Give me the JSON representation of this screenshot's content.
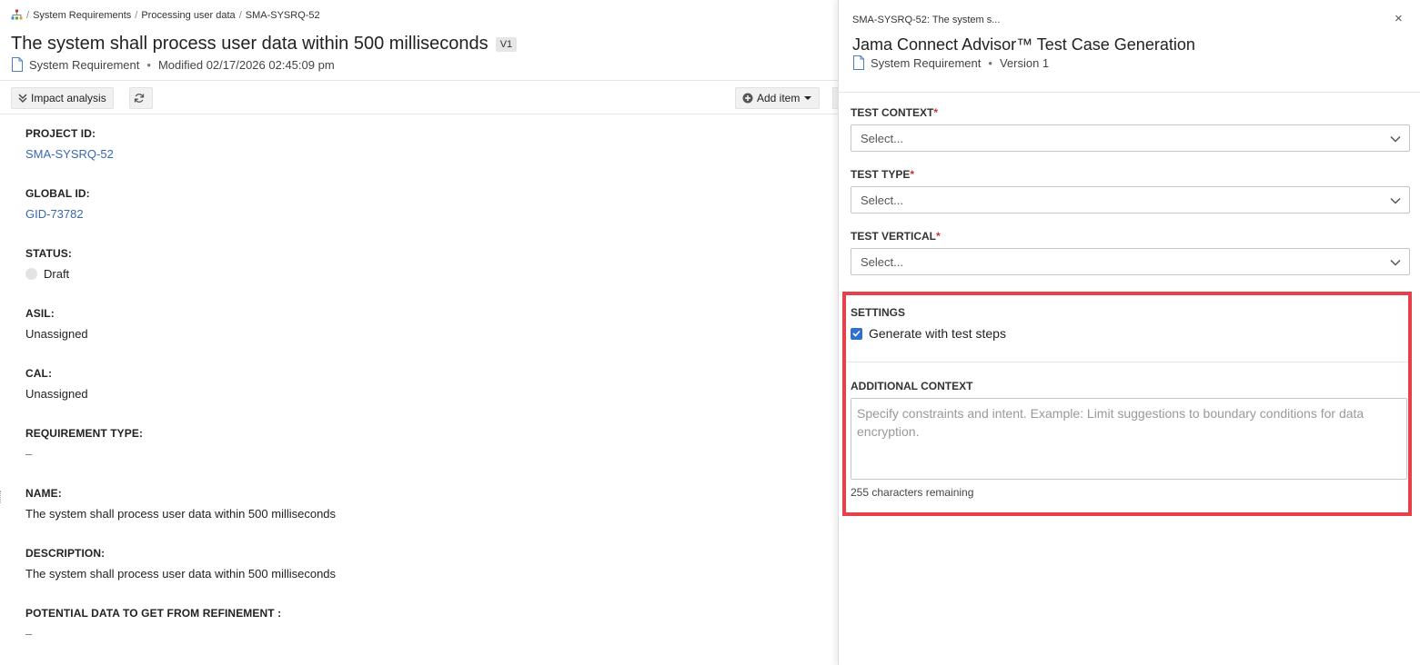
{
  "breadcrumb": {
    "items": [
      "System Requirements",
      "Processing user data",
      "SMA-SYSRQ-52"
    ]
  },
  "item": {
    "title": "The system shall process user data within 500 milliseconds",
    "version_badge": "V1",
    "type": "System Requirement",
    "modified": "Modified 02/17/2026 02:45:09 pm"
  },
  "toolbar": {
    "impact_label": "Impact analysis",
    "add_item_label": "Add item"
  },
  "fields": [
    {
      "label": "PROJECT ID:",
      "value": "SMA-SYSRQ-52"
    },
    {
      "label": "GLOBAL ID:",
      "value": "GID-73782"
    },
    {
      "label": "STATUS:",
      "value": "Draft"
    },
    {
      "label": "ASIL:",
      "value": "Unassigned"
    },
    {
      "label": "CAL:",
      "value": "Unassigned"
    },
    {
      "label": "REQUIREMENT TYPE:",
      "value": "–"
    },
    {
      "label": "NAME:",
      "value": "The system shall process user data within 500 milliseconds"
    },
    {
      "label": "DESCRIPTION:",
      "value": "The system shall process user data within 500 milliseconds"
    },
    {
      "label": "POTENTIAL DATA TO GET FROM REFINEMENT :",
      "value": "–"
    }
  ],
  "panel": {
    "crumb": "SMA-SYSRQ-52: The system s...",
    "close_icon": "×",
    "title": "Jama Connect Advisor™ Test Case Generation",
    "type": "System Requirement",
    "version": "Version 1",
    "test_context": {
      "label": "TEST CONTEXT",
      "required_mark": "*",
      "placeholder": "Select..."
    },
    "test_type": {
      "label": "TEST TYPE",
      "required_mark": "*",
      "placeholder": "Select..."
    },
    "test_vertical": {
      "label": "TEST VERTICAL",
      "required_mark": "*",
      "placeholder": "Select..."
    },
    "settings_label": "SETTINGS",
    "generate_steps": {
      "label": "Generate with test steps",
      "checked": true
    },
    "additional_context": {
      "label": "ADDITIONAL CONTEXT",
      "placeholder": "Specify constraints and intent. Example: Limit suggestions to boundary conditions for data encryption.",
      "chars_remaining": "255 characters remaining"
    }
  },
  "colors": {
    "link": "#3867b5",
    "highlight": "#e8404a",
    "checkbox": "#2e6fd0",
    "required": "#d0342c"
  }
}
